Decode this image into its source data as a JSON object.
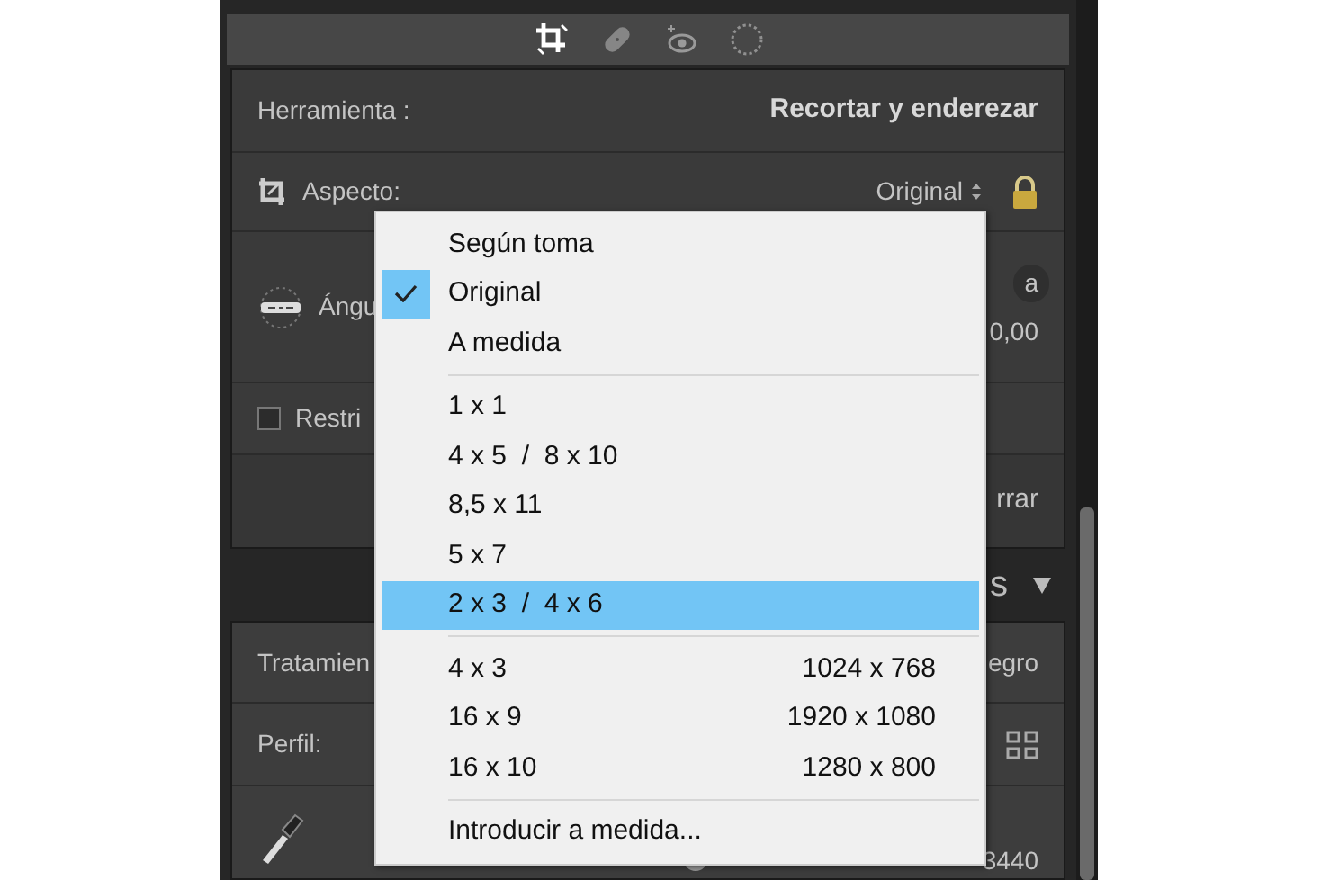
{
  "toolbar": {
    "tools": [
      {
        "kind": "crop",
        "selected": true
      },
      {
        "kind": "heal",
        "selected": false
      },
      {
        "kind": "redeye",
        "selected": false
      },
      {
        "kind": "mask",
        "selected": false
      }
    ]
  },
  "crop_panel": {
    "tool_label": "Herramienta :",
    "tool_name": "Recortar y enderezar",
    "aspect_label": "Aspecto:",
    "aspect_value": "Original",
    "locked": true,
    "angle_label": "Ángu",
    "angle_fragment": "a",
    "angle_value": "0,00",
    "constrain_label": "Restri",
    "constrain_checked": false,
    "close_fragment": "rrar"
  },
  "section_header": {
    "title": "s",
    "expanded": true
  },
  "basic_panel": {
    "treatment_label": "Tratamien",
    "treatment_value": "egro",
    "profile_label": "Perfil:",
    "temperature": {
      "value": "3440",
      "level": 0.45
    }
  },
  "menu": {
    "items": [
      {
        "kind": "option",
        "label": "Según toma",
        "checked": false,
        "highlighted": false
      },
      {
        "kind": "option",
        "label": "Original",
        "checked": true,
        "highlighted": false
      },
      {
        "kind": "option",
        "label": "A medida",
        "checked": false,
        "highlighted": false
      },
      {
        "kind": "separator"
      },
      {
        "kind": "option",
        "label": "1 x 1",
        "checked": false,
        "highlighted": false
      },
      {
        "kind": "option",
        "label": "4 x 5  /  8 x 10",
        "checked": false,
        "highlighted": false
      },
      {
        "kind": "option",
        "label": "8,5 x 11",
        "checked": false,
        "highlighted": false
      },
      {
        "kind": "option",
        "label": "5 x 7",
        "checked": false,
        "highlighted": false
      },
      {
        "kind": "option",
        "label": "2 x 3  /  4 x 6",
        "checked": false,
        "highlighted": true
      },
      {
        "kind": "separator"
      },
      {
        "kind": "option",
        "label": "4 x 3",
        "size": "1024 x 768",
        "checked": false,
        "highlighted": false
      },
      {
        "kind": "option",
        "label": "16 x 9",
        "size": "1920 x 1080",
        "checked": false,
        "highlighted": false
      },
      {
        "kind": "option",
        "label": "16 x 10",
        "size": "1280 x 800",
        "checked": false,
        "highlighted": false
      },
      {
        "kind": "separator"
      },
      {
        "kind": "option",
        "label": "Introducir a medida...",
        "checked": false,
        "highlighted": false
      }
    ]
  }
}
